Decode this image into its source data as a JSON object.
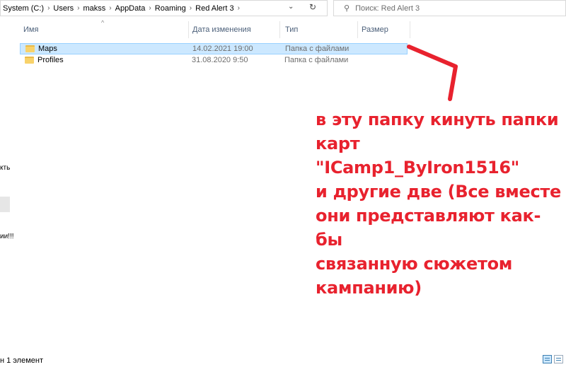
{
  "address_bar": {
    "crumbs": [
      "System (C:)",
      "Users",
      "makss",
      "AppData",
      "Roaming",
      "Red Alert 3"
    ],
    "separator": "›",
    "dropdown_glyph": "⌄",
    "refresh_glyph": "↻"
  },
  "search": {
    "placeholder": "Поиск: Red Alert 3",
    "icon": "search-icon",
    "icon_glyph": "⚲"
  },
  "columns": {
    "name": "Имя",
    "date": "Дата изменения",
    "type": "Тип",
    "size": "Размер",
    "sort_glyph": "^"
  },
  "files": [
    {
      "name": "Maps",
      "date": "14.02.2021 19:00",
      "type": "Папка с файлами",
      "selected": true
    },
    {
      "name": "Profiles",
      "date": "31.08.2020 9:50",
      "type": "Папка с файлами",
      "selected": false
    }
  ],
  "annotation": {
    "lines": [
      "в эту папку кинуть папки",
      "карт \"ꓲCamp1_ByIron1516\"",
      "и другие две (Все вместе",
      "они представляют как-бы",
      "связанную сюжетом",
      "кампанию)"
    ],
    "color": "#e8222e"
  },
  "left_panel_fragments": {
    "frag1": "кть",
    "frag2": "ии!!!"
  },
  "status_bar": {
    "text": "н 1 элемент"
  },
  "colors": {
    "selection_bg": "#cce8ff",
    "selection_border": "#99d1ff",
    "header_text": "#4c607a",
    "folder": "#f8d26a"
  }
}
